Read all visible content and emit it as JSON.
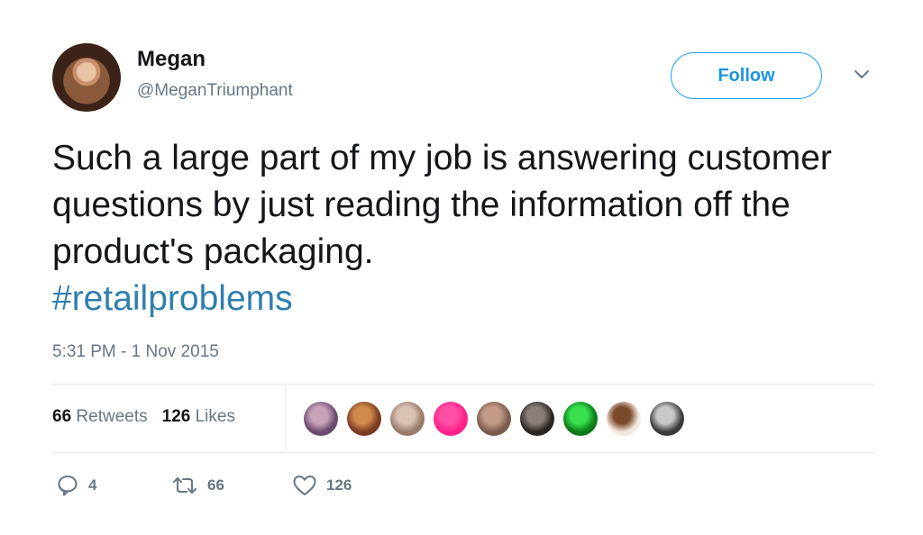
{
  "user": {
    "name": "Megan",
    "handle": "@MeganTriumphant"
  },
  "follow_label": "Follow",
  "tweet": {
    "text": "Such a large part of my job is answering customer questions by just reading the information off the product's packaging.",
    "hashtag": "#retailproblems",
    "timestamp": "5:31 PM - 1 Nov 2015"
  },
  "stats": {
    "retweets_count": "66",
    "retweets_label": "Retweets",
    "likes_count": "126",
    "likes_label": "Likes"
  },
  "likers": [
    {
      "colors": [
        "#6b4a6e",
        "#c8a2b8"
      ]
    },
    {
      "colors": [
        "#7a3b22",
        "#d08a4a"
      ]
    },
    {
      "colors": [
        "#9a7b6a",
        "#d9c2b4"
      ]
    },
    {
      "colors": [
        "#ff1f8a",
        "#ff4fa6"
      ]
    },
    {
      "colors": [
        "#7b5b4d",
        "#c29a86"
      ]
    },
    {
      "colors": [
        "#2a2522",
        "#8a7f78"
      ]
    },
    {
      "colors": [
        "#0c7a18",
        "#39e04e"
      ]
    },
    {
      "colors": [
        "#f4e9df",
        "#7b4a2b"
      ]
    },
    {
      "colors": [
        "#3a3a3a",
        "#c8c8c8"
      ]
    }
  ],
  "actions": {
    "replies": "4",
    "retweets": "66",
    "likes": "126"
  },
  "colors": {
    "accent": "#1da1f2",
    "hashtag": "#2f7fae",
    "muted": "#657786"
  }
}
